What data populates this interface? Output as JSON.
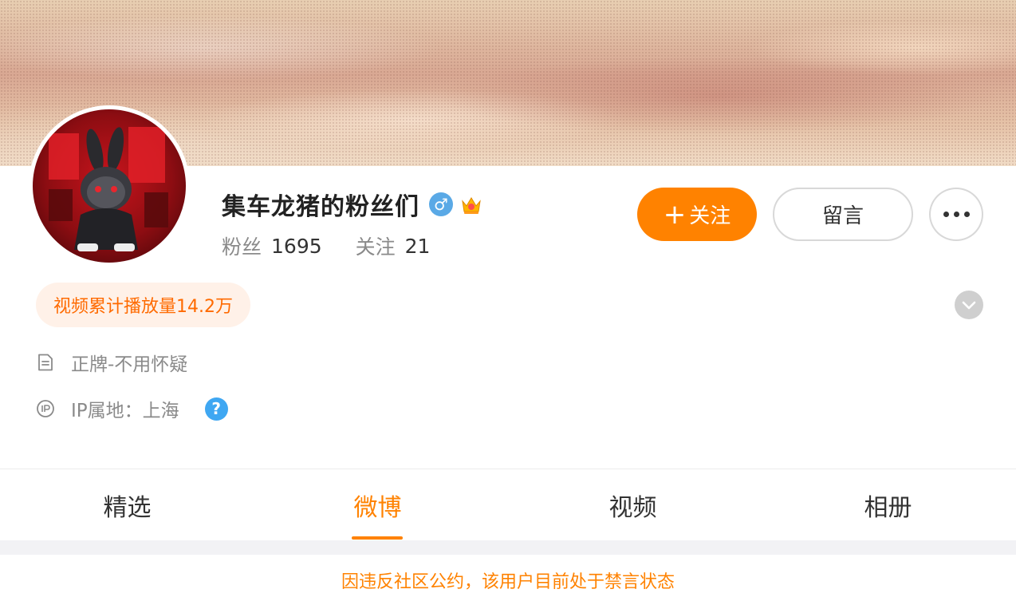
{
  "profile": {
    "username": "集车龙猪的粉丝们",
    "gender_symbol": "♂",
    "gender_icon": "male-icon",
    "badge_icon": "crown-icon",
    "fans_label": "粉丝",
    "fans_count": "1695",
    "following_label": "关注",
    "following_count": "21"
  },
  "actions": {
    "follow_plus": "+",
    "follow_label": "关注",
    "message_label": "留言",
    "more_icon": "more-dots-icon"
  },
  "highlights": {
    "views_badge": "视频累计播放量14.2万",
    "expand_icon": "chevron-down-icon"
  },
  "info": {
    "bio": "正牌-不用怀疑",
    "bio_icon": "document-icon",
    "ip_location": "IP属地：上海",
    "ip_icon": "ip-icon",
    "help_symbol": "?"
  },
  "tabs": [
    {
      "label": "精选",
      "active": false
    },
    {
      "label": "微博",
      "active": true
    },
    {
      "label": "视频",
      "active": false
    },
    {
      "label": "相册",
      "active": false
    }
  ],
  "notice": "因违反社区公约，该用户目前处于禁言状态",
  "colors": {
    "accent": "#ff8200",
    "badge_bg": "#fff1e8",
    "badge_text": "#ff6a00",
    "help_blue": "#3fa7f2",
    "male_blue": "#5aa9e6"
  }
}
